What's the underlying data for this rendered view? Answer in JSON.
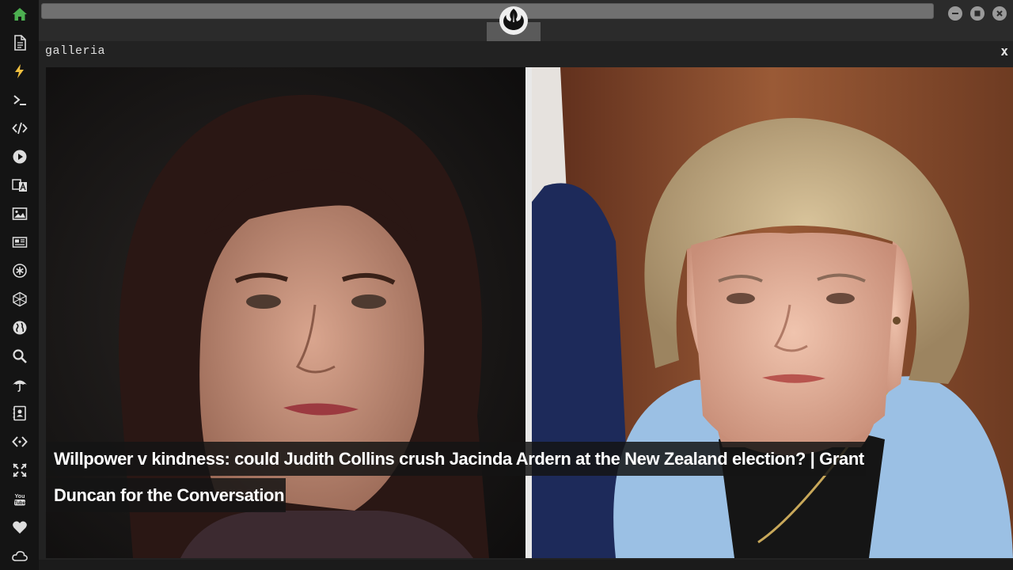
{
  "rail": {
    "icons": [
      "home-icon",
      "document-icon",
      "lightning-icon",
      "terminal-icon",
      "code-icon",
      "play-icon",
      "translate-icon",
      "image-icon",
      "newspaper-icon",
      "asterisk-circle-icon",
      "hexagon-icon",
      "globe-icon",
      "search-icon",
      "umbrella-icon",
      "contacts-icon",
      "code-brackets-icon",
      "expand-icon",
      "youtube-icon",
      "heart-icon",
      "cloud-icon"
    ],
    "youtube_text": "You Tube"
  },
  "viewer": {
    "title": "galleria",
    "close_label": "x",
    "caption": "Willpower v kindness: could Judith Collins crush Jacinda Ardern at the New Zealand election? | Grant Duncan for the Conversation"
  },
  "colors": {
    "rail_bg": "#141414",
    "home_active": "#4caf50",
    "lightning_active": "#f0c040",
    "window_button": "#9a9a9a"
  }
}
